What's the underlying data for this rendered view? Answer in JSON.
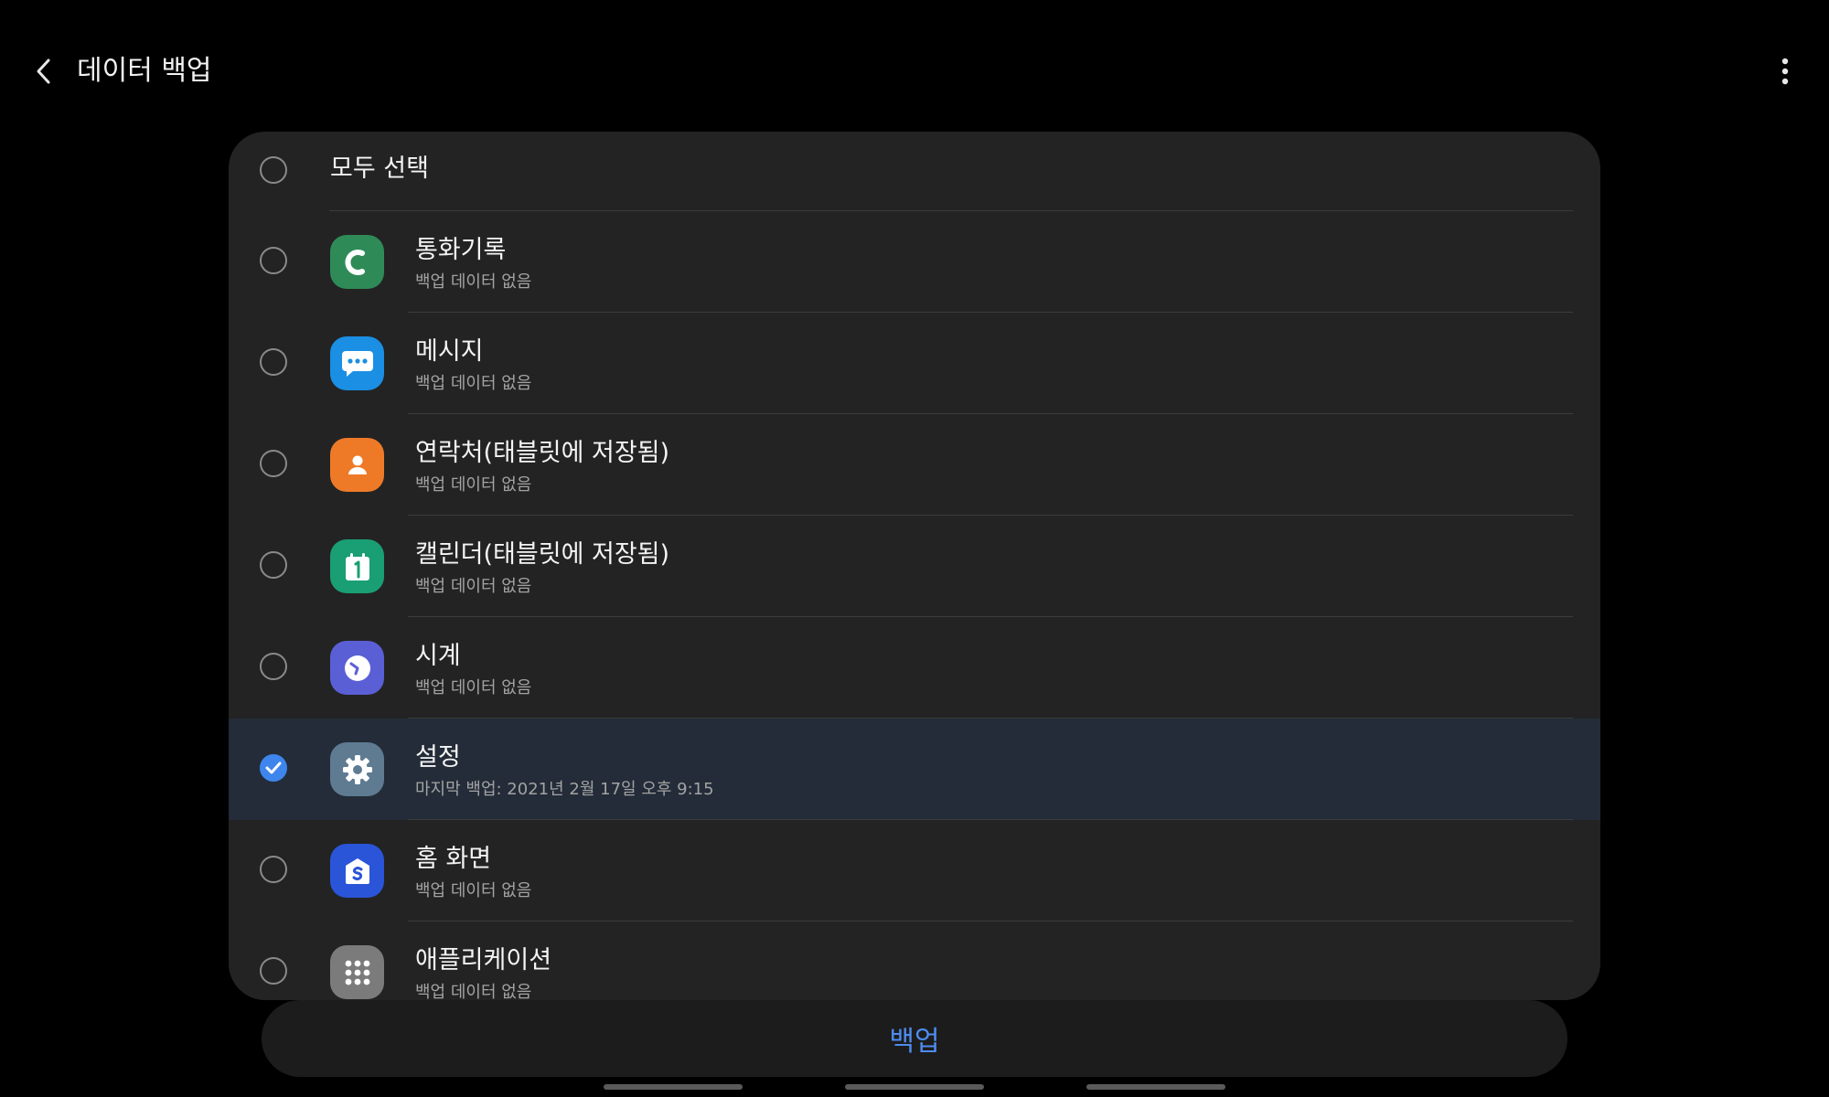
{
  "header": {
    "title": "데이터 백업"
  },
  "list": {
    "select_all_label": "모두 선택",
    "items": [
      {
        "label": "통화기록",
        "subtitle": "백업 데이터 없음",
        "icon": "phone-icon",
        "color": "#2e8b57",
        "checked": false
      },
      {
        "label": "메시지",
        "subtitle": "백업 데이터 없음",
        "icon": "message-icon",
        "color": "#1a8fe3",
        "checked": false
      },
      {
        "label": "연락처(태블릿에 저장됨)",
        "subtitle": "백업 데이터 없음",
        "icon": "contacts-icon",
        "color": "#ee7a28",
        "checked": false
      },
      {
        "label": "캘린더(태블릿에 저장됨)",
        "subtitle": "백업 데이터 없음",
        "icon": "calendar-icon",
        "color": "#1a9e74",
        "checked": false
      },
      {
        "label": "시계",
        "subtitle": "백업 데이터 없음",
        "icon": "clock-icon",
        "color": "#5b5fd6",
        "checked": false
      },
      {
        "label": "설정",
        "subtitle": "마지막 백업: 2021년 2월 17일 오후 9:15",
        "icon": "settings-gear-icon",
        "color": "#5f7b92",
        "checked": true
      },
      {
        "label": "홈 화면",
        "subtitle": "백업 데이터 없음",
        "icon": "home-screen-icon",
        "color": "#2a55d8",
        "checked": false
      },
      {
        "label": "애플리케이션",
        "subtitle": "백업 데이터 없음",
        "icon": "apps-grid-icon",
        "color": "#7b7b7b",
        "checked": false
      }
    ]
  },
  "footer": {
    "backup_button": "백업"
  },
  "colors": {
    "accent": "#3e86ed",
    "background": "#000000",
    "card": "#232323",
    "selected_row": "#232c38"
  }
}
